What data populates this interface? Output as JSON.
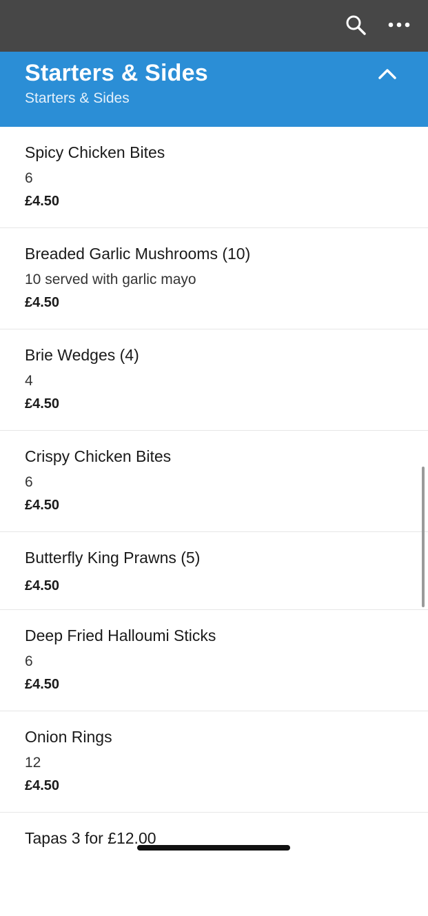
{
  "section": {
    "title": "Starters & Sides",
    "subtitle": "Starters & Sides"
  },
  "items": [
    {
      "name": "Spicy Chicken Bites",
      "desc": "6",
      "price": "£4.50"
    },
    {
      "name": "Breaded Garlic Mushrooms (10)",
      "desc": "10 served with garlic mayo",
      "price": "£4.50"
    },
    {
      "name": "Brie Wedges (4)",
      "desc": "4",
      "price": "£4.50"
    },
    {
      "name": "Crispy Chicken Bites",
      "desc": "6",
      "price": "£4.50"
    },
    {
      "name": "Butterfly King Prawns (5)",
      "price": "£4.50"
    },
    {
      "name": "Deep Fried Halloumi Sticks",
      "desc": "6",
      "price": "£4.50"
    },
    {
      "name": "Onion Rings",
      "desc": "12",
      "price": "£4.50"
    },
    {
      "name": "Tapas 3 for £12.00"
    }
  ],
  "icons": {
    "search": "search-icon",
    "more": "more-icon",
    "collapse": "chevron-up-icon"
  },
  "colors": {
    "topbar": "#474747",
    "header": "#2b8ed6"
  }
}
